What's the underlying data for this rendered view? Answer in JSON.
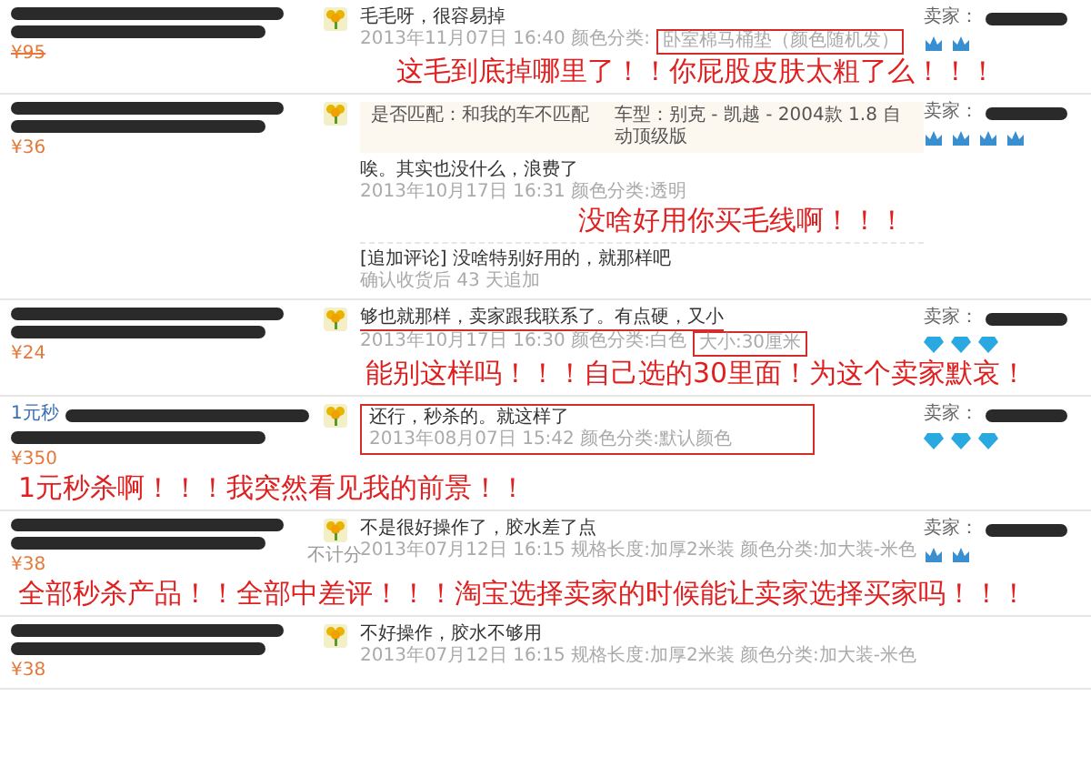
{
  "reviews": [
    {
      "product": {
        "price": "¥95",
        "price_struck": true
      },
      "rating": {
        "kind": "flower"
      },
      "text": {
        "value": "毛毛呀，很容易掉",
        "boxed": false,
        "underlined": false
      },
      "meta": [
        {
          "value": "2013年11月07日 16:40 颜色分类:",
          "boxed": false
        },
        {
          "value": "卧室棉马桶垫（颜色随机发）",
          "boxed": true
        }
      ],
      "seller": {
        "label": "卖家：",
        "badges": [
          {
            "kind": "crown"
          },
          {
            "kind": "crown"
          }
        ]
      },
      "annotation": "这毛到底掉哪里了！！你屁股皮肤太粗了么！！！"
    },
    {
      "product": {
        "price": "¥36",
        "price_struck": false
      },
      "rating": {
        "kind": "flower"
      },
      "match": {
        "label": "是否匹配：和我的车不匹配",
        "car": "车型：别克 - 凯越 - 2004款 1.8 自动顶级版"
      },
      "text": {
        "value": "唉。其实也没什么，浪费了",
        "boxed": false,
        "underlined": false
      },
      "meta": [
        {
          "value": "2013年10月17日 16:31 颜色分类:透明",
          "boxed": false
        }
      ],
      "annotation": "没啥好用你买毛线啊！！！",
      "followup": {
        "text": "[追加评论] 没啥特别好用的，就那样吧",
        "when": "确认收货后 43 天追加"
      },
      "seller": {
        "label": "卖家：",
        "badges": [
          {
            "kind": "crown"
          },
          {
            "kind": "crown"
          },
          {
            "kind": "crown"
          },
          {
            "kind": "crown"
          }
        ]
      }
    },
    {
      "product": {
        "price": "¥24",
        "price_struck": false
      },
      "rating": {
        "kind": "flower"
      },
      "text": {
        "value": "够也就那样，卖家跟我联系了。有点硬，又小",
        "boxed": false,
        "underlined": true
      },
      "meta": [
        {
          "value": "2013年10月17日 16:30 颜色分类:白色",
          "boxed": false
        },
        {
          "value": "大小:30厘米",
          "boxed": true
        }
      ],
      "seller": {
        "label": "卖家：",
        "badges": [
          {
            "kind": "diamond"
          },
          {
            "kind": "diamond"
          },
          {
            "kind": "diamond"
          }
        ]
      },
      "annotation": "能别这样吗！！！自己选的30里面！为这个卖家默哀！"
    },
    {
      "product": {
        "link": "1元秒",
        "price": "¥350",
        "price_struck": false
      },
      "rating": {
        "kind": "flower"
      },
      "text": {
        "value": "还行，秒杀的。就这样了",
        "boxed": true,
        "underlined": false
      },
      "meta": [
        {
          "value": "2013年08月07日 15:42 颜色分类:默认颜色",
          "boxed": false
        }
      ],
      "seller": {
        "label": "卖家：",
        "badges": [
          {
            "kind": "diamond"
          },
          {
            "kind": "diamond"
          },
          {
            "kind": "diamond"
          }
        ]
      },
      "banner": "1元秒杀啊！！！我突然看见我的前景！！"
    },
    {
      "product": {
        "price": "¥38",
        "price_struck": false
      },
      "rating": {
        "kind": "flower",
        "note": "不计分"
      },
      "text": {
        "value": "不是很好操作了，胶水差了点",
        "boxed": false,
        "underlined": false
      },
      "meta": [
        {
          "value": "2013年07月12日 16:15 规格长度:加厚2米装  颜色分类:加大装-米色",
          "boxed": false
        }
      ],
      "seller": {
        "label": "卖家：",
        "badges": [
          {
            "kind": "crown"
          },
          {
            "kind": "crown"
          }
        ]
      },
      "banner": "全部秒杀产品！！全部中差评！！！淘宝选择卖家的时候能让卖家选择买家吗！！！"
    },
    {
      "product": {
        "price": "¥38",
        "price_struck": false
      },
      "rating": {
        "kind": "flower"
      },
      "text": {
        "value": "不好操作，胶水不够用",
        "boxed": false,
        "underlined": false
      },
      "meta": [
        {
          "value": "2013年07月12日 16:15 规格长度:加厚2米装  颜色分类:加大装-米色",
          "boxed": false
        }
      ]
    }
  ]
}
